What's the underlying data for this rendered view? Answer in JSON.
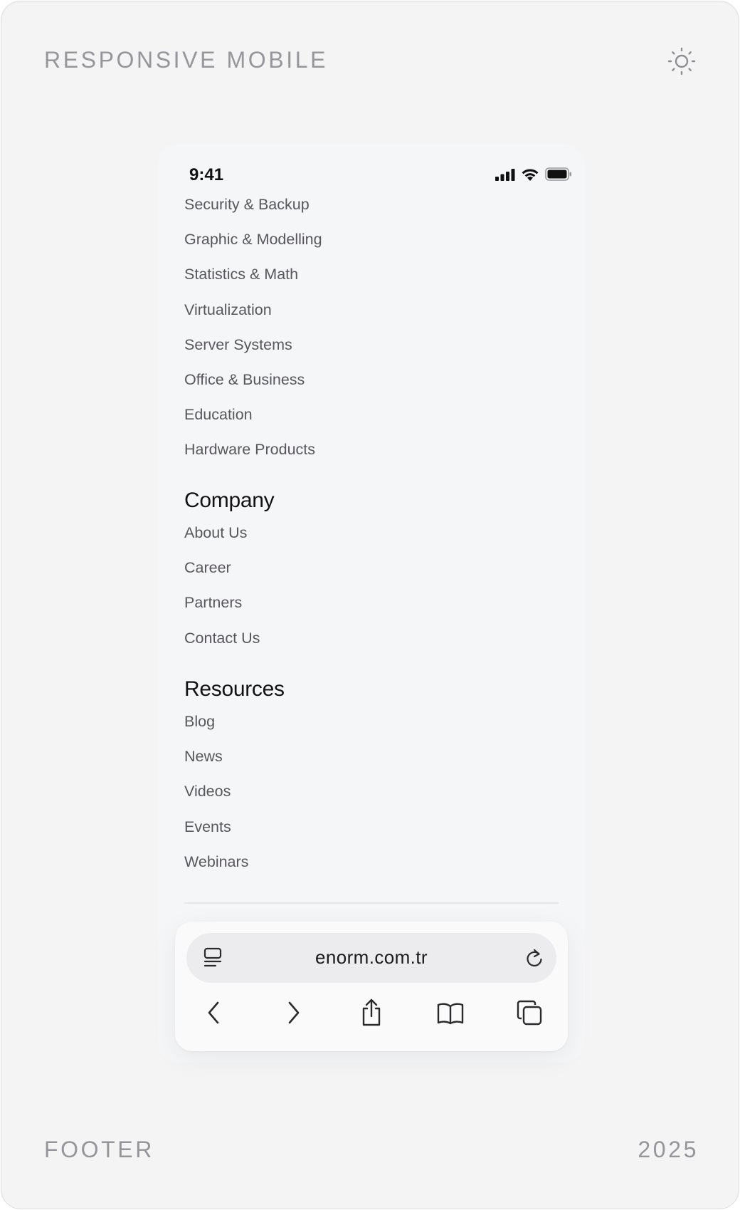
{
  "card": {
    "title": "RESPONSIVE MOBILE",
    "footer_label": "FOOTER",
    "year": "2025",
    "theme_icon": "sun-icon"
  },
  "status_bar": {
    "time": "9:41",
    "icons": [
      "cellular-signal-icon",
      "wifi-icon",
      "battery-icon"
    ]
  },
  "menu": {
    "products": [
      "Security & Backup",
      "Graphic & Modelling",
      "Statistics & Math",
      "Virtualization",
      "Server Systems",
      "Office & Business",
      "Education",
      "Hardware Products"
    ],
    "company": {
      "title": "Company",
      "links": [
        "About Us",
        "Career",
        "Partners",
        "Contact Us"
      ]
    },
    "resources": {
      "title": "Resources",
      "links": [
        "Blog",
        "News",
        "Videos",
        "Events",
        "Webinars"
      ]
    }
  },
  "browser": {
    "url": "enorm.com.tr",
    "url_left_icon": "reader-mode-icon",
    "reload_icon": "reload-icon",
    "nav_icons": [
      "back-icon",
      "forward-icon",
      "share-icon",
      "bookmarks-icon",
      "tabs-icon"
    ]
  },
  "colors": {
    "card_bg": "#f4f4f5",
    "phone_bg": "#f5f6f8",
    "muted_label": "#95959a",
    "link": "#57575c",
    "heading": "#121214"
  }
}
